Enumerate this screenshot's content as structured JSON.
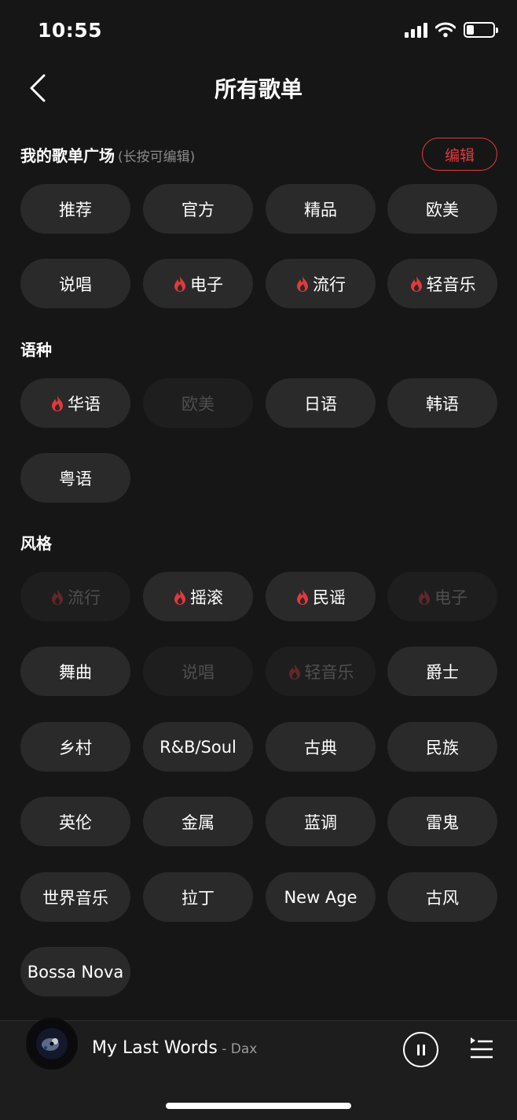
{
  "status": {
    "time": "10:55"
  },
  "nav": {
    "title": "所有歌单"
  },
  "my_square": {
    "heading": "我的歌单广场",
    "hint": "(长按可编辑)",
    "edit_label": "编辑",
    "chips": [
      {
        "label": "推荐",
        "hot": false,
        "enabled": true
      },
      {
        "label": "官方",
        "hot": false,
        "enabled": true
      },
      {
        "label": "精品",
        "hot": false,
        "enabled": true
      },
      {
        "label": "欧美",
        "hot": false,
        "enabled": true
      },
      {
        "label": "说唱",
        "hot": false,
        "enabled": true
      },
      {
        "label": "电子",
        "hot": true,
        "enabled": true
      },
      {
        "label": "流行",
        "hot": true,
        "enabled": true
      },
      {
        "label": "轻音乐",
        "hot": true,
        "enabled": true
      }
    ]
  },
  "language": {
    "heading": "语种",
    "chips": [
      {
        "label": "华语",
        "hot": true,
        "enabled": true
      },
      {
        "label": "欧美",
        "hot": false,
        "enabled": false
      },
      {
        "label": "日语",
        "hot": false,
        "enabled": true
      },
      {
        "label": "韩语",
        "hot": false,
        "enabled": true
      },
      {
        "label": "粤语",
        "hot": false,
        "enabled": true
      }
    ]
  },
  "style": {
    "heading": "风格",
    "chips": [
      {
        "label": "流行",
        "hot": true,
        "enabled": false
      },
      {
        "label": "摇滚",
        "hot": true,
        "enabled": true
      },
      {
        "label": "民谣",
        "hot": true,
        "enabled": true
      },
      {
        "label": "电子",
        "hot": true,
        "enabled": false
      },
      {
        "label": "舞曲",
        "hot": false,
        "enabled": true
      },
      {
        "label": "说唱",
        "hot": false,
        "enabled": false
      },
      {
        "label": "轻音乐",
        "hot": true,
        "enabled": false
      },
      {
        "label": "爵士",
        "hot": false,
        "enabled": true
      },
      {
        "label": "乡村",
        "hot": false,
        "enabled": true
      },
      {
        "label": "R&B/Soul",
        "hot": false,
        "enabled": true
      },
      {
        "label": "古典",
        "hot": false,
        "enabled": true
      },
      {
        "label": "民族",
        "hot": false,
        "enabled": true
      },
      {
        "label": "英伦",
        "hot": false,
        "enabled": true
      },
      {
        "label": "金属",
        "hot": false,
        "enabled": true
      },
      {
        "label": "蓝调",
        "hot": false,
        "enabled": true
      },
      {
        "label": "雷鬼",
        "hot": false,
        "enabled": true
      },
      {
        "label": "世界音乐",
        "hot": false,
        "enabled": true
      },
      {
        "label": "拉丁",
        "hot": false,
        "enabled": true
      },
      {
        "label": "New Age",
        "hot": false,
        "enabled": true
      },
      {
        "label": "古风",
        "hot": false,
        "enabled": true
      },
      {
        "label": "Bossa Nova",
        "hot": false,
        "enabled": true
      }
    ]
  },
  "player": {
    "title": "My Last Words",
    "artist": " - Dax",
    "state": "playing"
  },
  "colors": {
    "accent": "#e0393e",
    "background": "#161616",
    "chip": "#2a2a2a",
    "chip_disabled_text": "#4e4e4e"
  },
  "icons": {
    "back": "chevron-left-icon",
    "hot": "flame-icon",
    "pause": "pause-icon",
    "playlist": "playlist-icon"
  }
}
